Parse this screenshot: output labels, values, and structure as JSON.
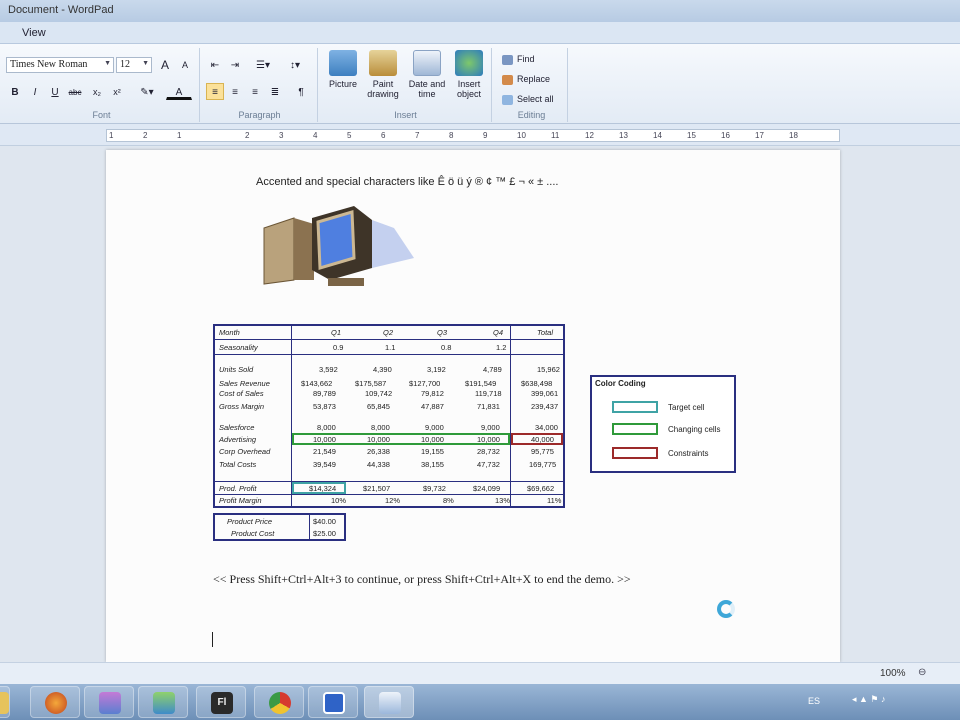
{
  "window": {
    "title": "Document - WordPad"
  },
  "menu": {
    "view": "View"
  },
  "font_group": {
    "font_name": "Times New Roman",
    "font_size": "12",
    "label": "Font",
    "buttons": {
      "bold": "B",
      "italic": "I",
      "underline": "U",
      "strike": "abc",
      "sub": "x₂",
      "sup": "x²",
      "grow": "A",
      "shrink": "A",
      "color": "A"
    }
  },
  "paragraph_group": {
    "label": "Paragraph"
  },
  "insert_group": {
    "label": "Insert",
    "picture": "Picture",
    "paint": "Paint drawing",
    "datetime": "Date and time",
    "object": "Insert object"
  },
  "editing_group": {
    "label": "Editing",
    "find": "Find",
    "replace": "Replace",
    "select_all": "Select all"
  },
  "ruler": {
    "ticks": [
      "1",
      "2",
      "1",
      "2",
      "3",
      "4",
      "5",
      "6",
      "7",
      "8",
      "9",
      "10",
      "11",
      "12",
      "13",
      "14",
      "15",
      "16",
      "17",
      "18"
    ]
  },
  "document": {
    "accent_line": "Accented and special characters like Ê ö ü ý ® ¢ ™ £ ¬ « ± ....",
    "spreadsheet": {
      "header": [
        "Month",
        "Q1",
        "Q2",
        "Q3",
        "Q4",
        "Total"
      ],
      "seasonality": {
        "label": "Seasonality",
        "values": [
          "0.9",
          "1.1",
          "0.8",
          "1.2",
          ""
        ]
      },
      "units_sold": {
        "label": "Units Sold",
        "values": [
          "3,592",
          "4,390",
          "3,192",
          "4,789",
          "15,962"
        ]
      },
      "sales_revenue": {
        "label": "Sales Revenue",
        "values": [
          "$143,662",
          "$175,587",
          "$127,700",
          "$191,549",
          "$638,498"
        ]
      },
      "cost_of_sales": {
        "label": "Cost of Sales",
        "values": [
          "89,789",
          "109,742",
          "79,812",
          "119,718",
          "399,061"
        ]
      },
      "gross_margin": {
        "label": "Gross Margin",
        "values": [
          "53,873",
          "65,845",
          "47,887",
          "71,831",
          "239,437"
        ]
      },
      "salesforce": {
        "label": "Salesforce",
        "values": [
          "8,000",
          "8,000",
          "9,000",
          "9,000",
          "34,000"
        ]
      },
      "advertising": {
        "label": "Advertising",
        "values": [
          "10,000",
          "10,000",
          "10,000",
          "10,000",
          "40,000"
        ]
      },
      "corp_overhead": {
        "label": "Corp Overhead",
        "values": [
          "21,549",
          "26,338",
          "19,155",
          "28,732",
          "95,775"
        ]
      },
      "total_costs": {
        "label": "Total Costs",
        "values": [
          "39,549",
          "44,338",
          "38,155",
          "47,732",
          "169,775"
        ]
      },
      "prod_profit": {
        "label": "Prod. Profit",
        "values": [
          "$14,324",
          "$21,507",
          "$9,732",
          "$24,099",
          "$69,662"
        ]
      },
      "profit_margin": {
        "label": "Profit Margin",
        "values": [
          "10%",
          "12%",
          "8%",
          "13%",
          "11%"
        ]
      }
    },
    "price_box": {
      "product_price_label": "Product Price",
      "product_price": "$40.00",
      "product_cost_label": "Product Cost",
      "product_cost": "$25.00"
    },
    "legend": {
      "title": "Color Coding",
      "items": [
        {
          "label": "Target cell",
          "color": "#3fa3a5"
        },
        {
          "label": "Changing cells",
          "color": "#2f9a3a"
        },
        {
          "label": "Constraints",
          "color": "#9c2a2a"
        }
      ]
    },
    "instruction": "<< Press Shift+Ctrl+Alt+3 to continue, or press Shift+Ctrl+Alt+X to end the demo. >>"
  },
  "status": {
    "zoom": "100%"
  },
  "tray": {
    "lang": "ES"
  },
  "colors": {
    "border_navy": "#2a2f80"
  }
}
